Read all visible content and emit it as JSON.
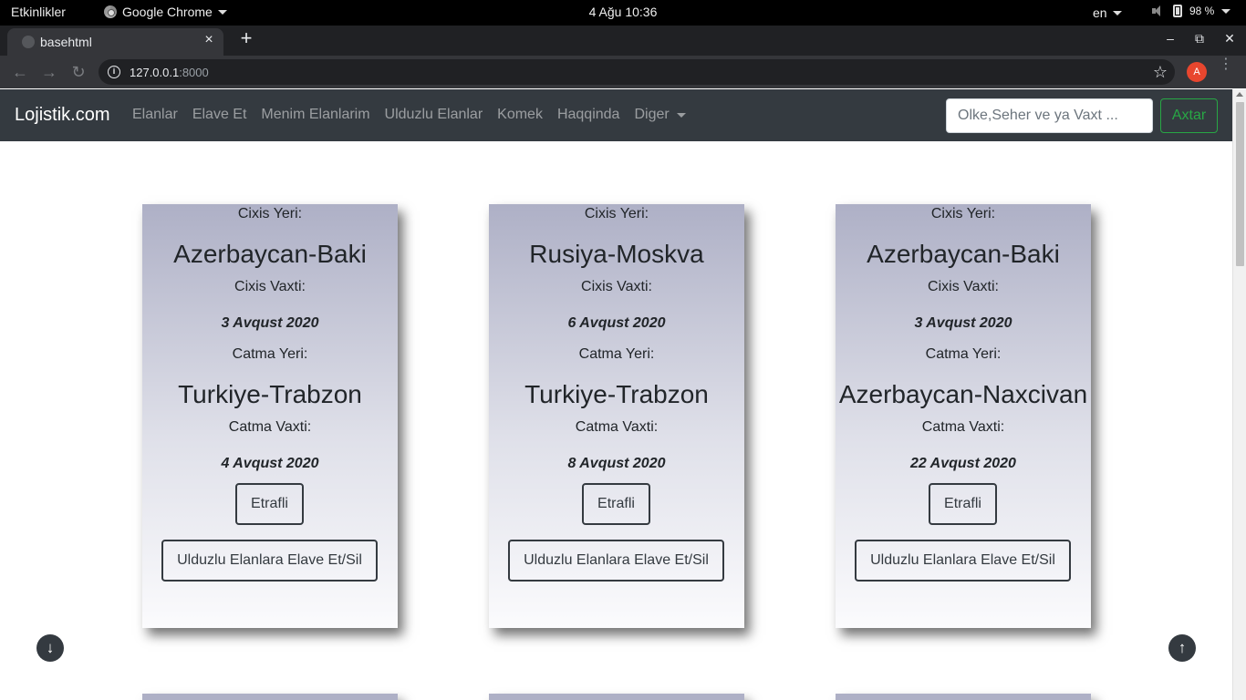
{
  "system_bar": {
    "activities": "Etkinlikler",
    "app_name": "Google Chrome",
    "clock": "4 Ağu  10:36",
    "language": "en",
    "battery": "98 %"
  },
  "browser": {
    "tab_title": "basehtml",
    "tab_close": "×",
    "new_tab": "+",
    "minimize": "–",
    "restore": "⧉",
    "close": "✕",
    "url_host": "127.0.0.1",
    "url_port": ":8000",
    "avatar_letter": "A",
    "back": "←",
    "forward": "→",
    "reload": "↻",
    "star": "☆",
    "menu": "⋮"
  },
  "navbar": {
    "brand": "Lojistik.com",
    "links": [
      "Elanlar",
      "Elave Et",
      "Menim Elanlarim",
      "Ulduzlu Elanlar",
      "Komek",
      "Haqqinda"
    ],
    "dropdown": "Diger",
    "search_placeholder": "Olke,Seher ve ya Vaxt ...",
    "search_button": "Axtar"
  },
  "cards": [
    {
      "departure_label": "Cixis Yeri:",
      "departure_place": "Azerbaycan-Baki",
      "departure_time_label": "Cixis Vaxti:",
      "departure_date": "3 Avqust 2020",
      "arrival_label": "Catma Yeri:",
      "arrival_place": "Turkiye-Trabzon",
      "arrival_time_label": "Catma Vaxti:",
      "arrival_date": "4 Avqust 2020",
      "details_button": "Etrafli",
      "favorite_button": "Ulduzlu Elanlara Elave Et/Sil"
    },
    {
      "departure_label": "Cixis Yeri:",
      "departure_place": "Rusiya-Moskva",
      "departure_time_label": "Cixis Vaxti:",
      "departure_date": "6 Avqust 2020",
      "arrival_label": "Catma Yeri:",
      "arrival_place": "Turkiye-Trabzon",
      "arrival_time_label": "Catma Vaxti:",
      "arrival_date": "8 Avqust 2020",
      "details_button": "Etrafli",
      "favorite_button": "Ulduzlu Elanlara Elave Et/Sil"
    },
    {
      "departure_label": "Cixis Yeri:",
      "departure_place": "Azerbaycan-Baki",
      "departure_time_label": "Cixis Vaxti:",
      "departure_date": "3 Avqust 2020",
      "arrival_label": "Catma Yeri:",
      "arrival_place": "Azerbaycan-Naxcivan",
      "arrival_time_label": "Catma Vaxti:",
      "arrival_date": "22 Avqust 2020",
      "details_button": "Etrafli",
      "favorite_button": "Ulduzlu Elanlara Elave Et/Sil"
    }
  ],
  "scroll_buttons": {
    "down": "↓",
    "up": "↑"
  }
}
